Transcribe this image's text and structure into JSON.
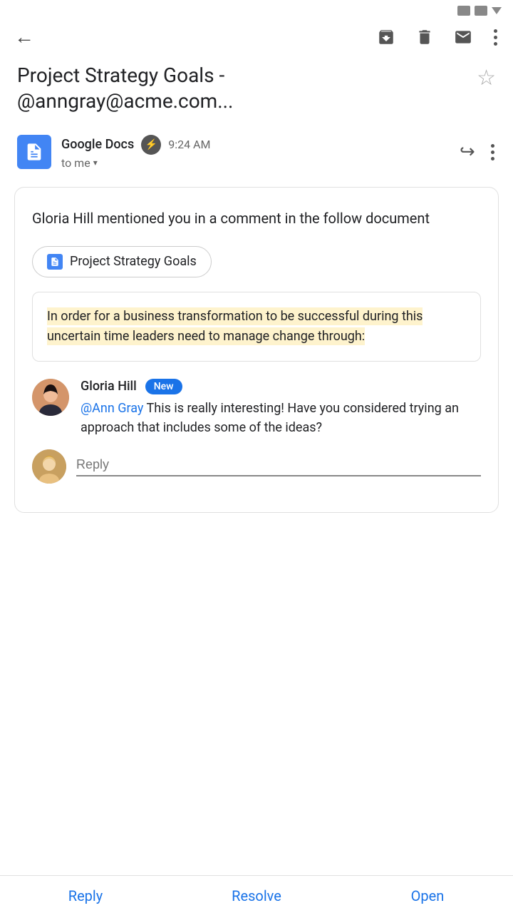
{
  "statusBar": {
    "icons": [
      "signal1",
      "signal2",
      "dropdown"
    ]
  },
  "toolbar": {
    "back_label": "←",
    "archive_label": "archive",
    "delete_label": "delete",
    "mail_label": "mail",
    "more_label": "more"
  },
  "subject": {
    "title": "Project Strategy Goals -",
    "subtitle": "@anngray@acme.com...",
    "star_label": "☆"
  },
  "sender": {
    "name": "Google Docs",
    "time": "9:24 AM",
    "to_label": "to me",
    "caret": "▾"
  },
  "emailBody": {
    "mention_text": "Gloria Hill mentioned you in a comment in the follow document",
    "doc_link_label": "Project Strategy Goals",
    "quote_text": "In order for a business transformation to be successful during this uncertain time leaders need to manage change through:"
  },
  "comment": {
    "commenter": "Gloria Hill",
    "badge": "New",
    "mention": "@Ann Gray",
    "body": " This is really interesting! Have you considered trying an approach that includes some of the ideas?"
  },
  "replyInput": {
    "placeholder": "Reply"
  },
  "bottomBar": {
    "reply": "Reply",
    "resolve": "Resolve",
    "open": "Open"
  }
}
